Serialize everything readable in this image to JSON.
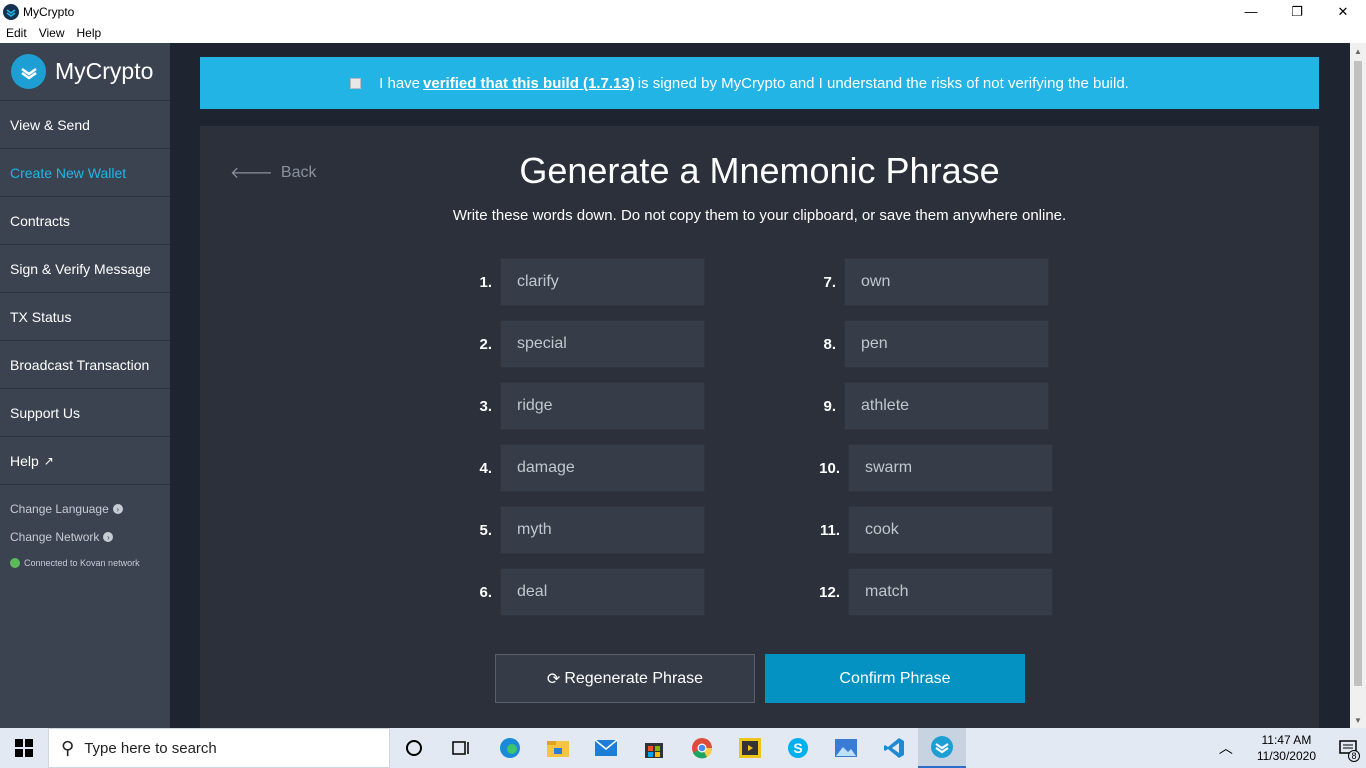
{
  "window": {
    "title": "MyCrypto",
    "minimize": "—",
    "restore": "❐",
    "close": "✕"
  },
  "menu": [
    "Edit",
    "View",
    "Help"
  ],
  "sidebar": {
    "logo": "MyCrypto",
    "items": [
      {
        "label": "View & Send"
      },
      {
        "label": "Create New Wallet",
        "active": true
      },
      {
        "label": "Contracts"
      },
      {
        "label": "Sign & Verify Message"
      },
      {
        "label": "TX Status"
      },
      {
        "label": "Broadcast Transaction"
      },
      {
        "label": "Support Us"
      },
      {
        "label": "Help"
      }
    ],
    "change_language": "Change Language",
    "change_network": "Change Network",
    "network_status": "Connected to Kovan network"
  },
  "banner": {
    "prefix": "I have",
    "link": "verified that this build (1.7.13)",
    "suffix": "is signed by MyCrypto and I understand the risks of not verifying the build."
  },
  "main": {
    "back": "Back",
    "title": "Generate a Mnemonic Phrase",
    "subtitle": "Write these words down. Do not copy them to your clipboard, or save them anywhere online.",
    "words": [
      {
        "num": "1.",
        "word": "clarify"
      },
      {
        "num": "2.",
        "word": "special"
      },
      {
        "num": "3.",
        "word": "ridge"
      },
      {
        "num": "4.",
        "word": "damage"
      },
      {
        "num": "5.",
        "word": "myth"
      },
      {
        "num": "6.",
        "word": "deal"
      },
      {
        "num": "7.",
        "word": "own"
      },
      {
        "num": "8.",
        "word": "pen"
      },
      {
        "num": "9.",
        "word": "athlete"
      },
      {
        "num": "10.",
        "word": "swarm"
      },
      {
        "num": "11.",
        "word": "cook"
      },
      {
        "num": "12.",
        "word": "match"
      }
    ],
    "regenerate": "Regenerate Phrase",
    "confirm": "Confirm Phrase"
  },
  "taskbar": {
    "search_placeholder": "Type here to search",
    "time": "11:47 AM",
    "date": "11/30/2020",
    "notification_count": "8"
  }
}
